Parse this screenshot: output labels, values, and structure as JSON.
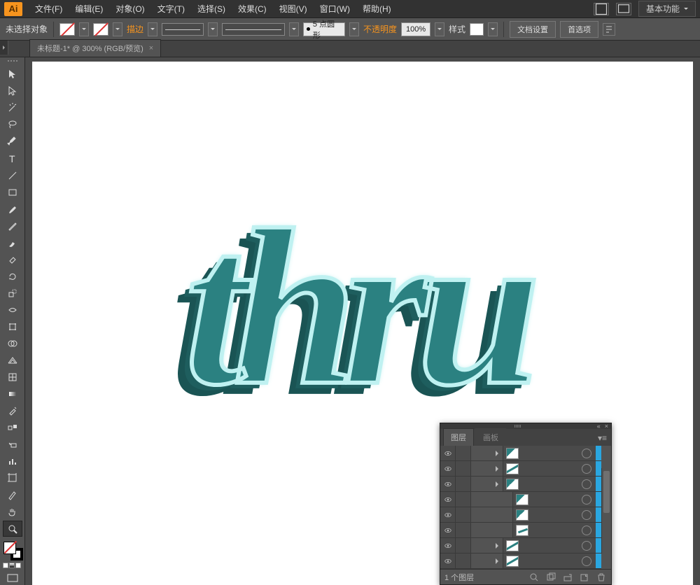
{
  "app": {
    "logo": "Ai",
    "workspace": "基本功能"
  },
  "menu": {
    "file": "文件(F)",
    "edit": "编辑(E)",
    "object": "对象(O)",
    "type": "文字(T)",
    "select": "选择(S)",
    "effect": "效果(C)",
    "view": "视图(V)",
    "window": "窗口(W)",
    "help": "帮助(H)"
  },
  "control": {
    "no_selection": "未选择对象",
    "stroke_label": "描边",
    "stroke_value": "5 点圆形",
    "opacity_label": "不透明度",
    "opacity_value": "100%",
    "style_label": "样式",
    "doc_setup": "文档设置",
    "prefs": "首选项"
  },
  "tab": {
    "title": "未标题-1* @ 300% (RGB/预览)",
    "close": "×"
  },
  "art": {
    "text": "thru"
  },
  "layers": {
    "tab_layers": "图层",
    "tab_artboards": "画板",
    "rows": [
      {
        "depth": 1,
        "thumb": "teal",
        "sw": "#2aa6e0"
      },
      {
        "depth": 1,
        "thumb": "stripe",
        "sw": "#2aa6e0"
      },
      {
        "depth": 1,
        "thumb": "teal",
        "sw": "#2aa6e0"
      },
      {
        "depth": 2,
        "thumb": "teal",
        "sw": "#2aa6e0"
      },
      {
        "depth": 2,
        "thumb": "teal",
        "sw": "#2aa6e0"
      },
      {
        "depth": 2,
        "thumb": "multi",
        "sw": "#2aa6e0"
      },
      {
        "depth": 1,
        "thumb": "stripe",
        "sw": "#2aa6e0"
      },
      {
        "depth": 1,
        "thumb": "stripe",
        "sw": "#2aa6e0"
      }
    ],
    "status_count": "1 个图层",
    "collapse": "«",
    "close": "×"
  }
}
